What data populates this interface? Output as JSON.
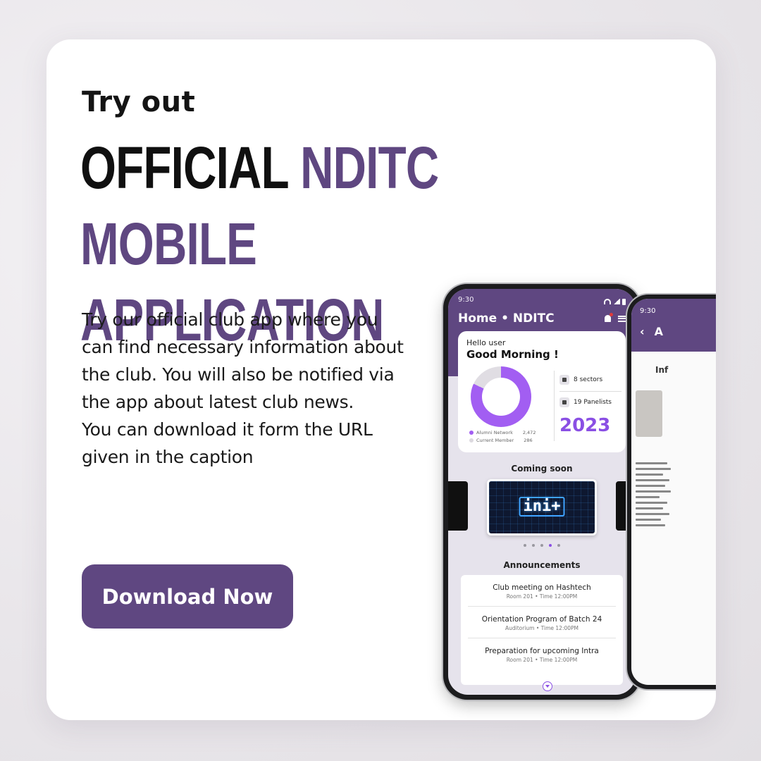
{
  "headline": {
    "try_out": "Try out",
    "line_dark": "OFFICIAL",
    "line_accent_1": "NDITC MOBILE",
    "line_accent_2": "APPLICATION"
  },
  "description": {
    "paragraph_1": "Try our official club app where you can find necessary information about the club. You will also be notified via the app about latest club news.",
    "paragraph_2": "You can download it form the URL given in the caption"
  },
  "cta": {
    "label": "Download Now"
  },
  "colors": {
    "accent": "#5f4781",
    "chart_purple": "#a25ef2",
    "year_purple": "#8a4fe4"
  },
  "phone_main": {
    "status_time": "9:30",
    "app_title": "Home • NDITC",
    "hello": "Hello user",
    "greeting": "Good Morning !",
    "legend": [
      {
        "label": "Alumni Network",
        "value": "2,472"
      },
      {
        "label": "Current Member",
        "value": "286"
      }
    ],
    "stats": [
      {
        "label": "8 sectors"
      },
      {
        "label": "19 Panelists"
      }
    ],
    "year": "2023",
    "coming_soon_title": "Coming soon",
    "carousel_banner": "ini+",
    "announcements_title": "Announcements",
    "announcements": [
      {
        "title": "Club meeting on Hashtech",
        "subtitle": "Room 201 • Time 12:00PM"
      },
      {
        "title": "Orientation Program of Batch 24",
        "subtitle": "Auditorium • Time 12:00PM"
      },
      {
        "title": "Preparation for upcoming Intra",
        "subtitle": "Room 201 • Time 12:00PM"
      }
    ]
  },
  "phone_secondary": {
    "status_time": "9:30",
    "header_partial": "A",
    "section_partial": "Inf"
  }
}
